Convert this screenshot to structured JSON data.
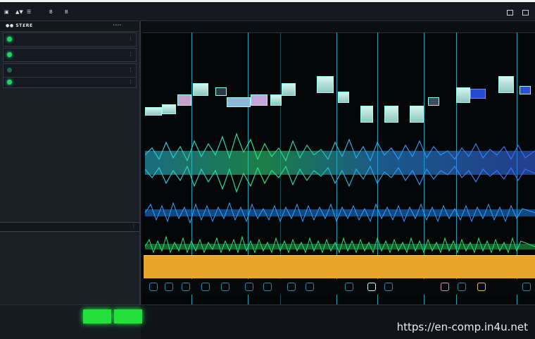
{
  "window": {
    "title": "",
    "toolbar": [
      "▣",
      "▲▼",
      "☰",
      "B",
      "B"
    ]
  },
  "sidebar": {
    "header": "●● ST£RE",
    "header_extra": "∙∙∙∙",
    "tracks": [
      {
        "label": "",
        "more": "⋮"
      },
      {
        "label": "",
        "more": "⋮"
      },
      {
        "label": "",
        "more": "⋮"
      },
      {
        "label": "",
        "more": "⋮"
      }
    ],
    "divider_label": "",
    "divider_more": "⋮"
  },
  "bottom": {
    "status": "",
    "watermark": "https://en-comp.in4u.net"
  },
  "ruler": {
    "marks": [
      "",
      "",
      "",
      "",
      ""
    ]
  },
  "colors": {
    "accent": "#2fb9cf",
    "green": "#23e03c",
    "yellow_clip": "#e8a52a",
    "wave_blue": "#1a8cff",
    "wave_green": "#27d65b"
  }
}
